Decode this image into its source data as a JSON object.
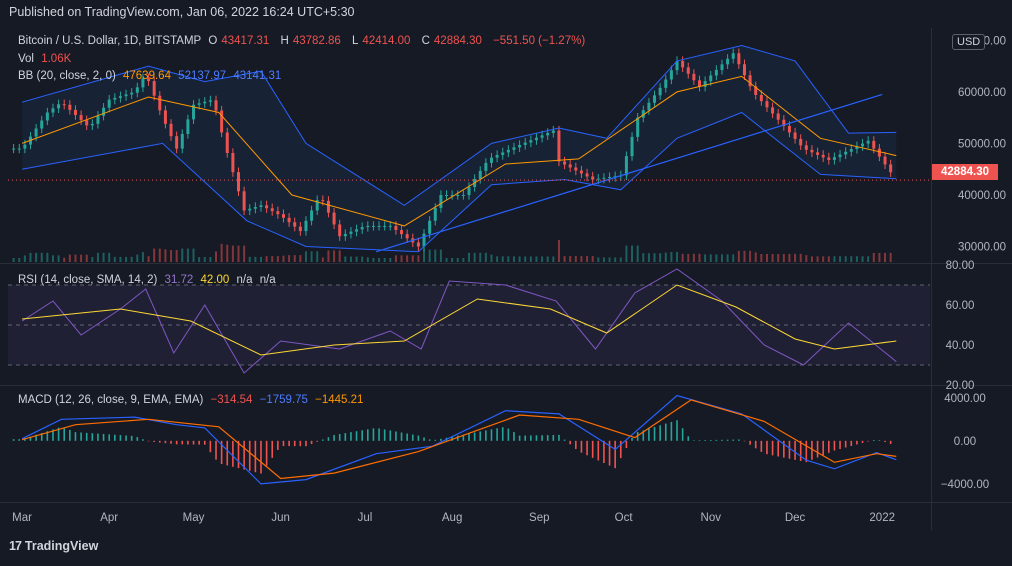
{
  "header": {
    "published": "Published on TradingView.com, Jan 06, 2022 16:24 UTC+5:30"
  },
  "symbol": {
    "name": "Bitcoin / U.S. Dollar, 1D, BITSTAMP",
    "o_label": "O",
    "o_value": "43417.31",
    "h_label": "H",
    "h_value": "43782.86",
    "l_label": "L",
    "l_value": "42414.00",
    "c_label": "C",
    "c_value": "42884.30",
    "change": "−551.50 (−1.27%)"
  },
  "volume": {
    "label": "Vol",
    "value": "1.06K"
  },
  "bb": {
    "label": "BB (20, close, 2, 0)",
    "basis": "47639.64",
    "upper": "52137.97",
    "lower": "43141.31"
  },
  "rsi": {
    "label": "RSI (14, close, SMA, 14, 2)",
    "rsi": "31.72",
    "sma": "42.00",
    "na1": "n/a",
    "na2": "n/a"
  },
  "macd": {
    "label": "MACD (12, 26, close, 9, EMA, EMA)",
    "hist": "−314.54",
    "macd": "−1759.75",
    "signal": "−1445.21"
  },
  "price_axis": {
    "currency": "USD",
    "last_price": "42884.30",
    "ticks": [
      "70000.00",
      "60000.00",
      "50000.00",
      "40000.00",
      "30000.00"
    ],
    "rsi_ticks": [
      "80.00",
      "60.00",
      "40.00",
      "20.00"
    ],
    "macd_ticks": [
      "4000.00",
      "0.00",
      "−4000.00"
    ]
  },
  "time_axis": [
    "Mar",
    "Apr",
    "May",
    "Jun",
    "Jul",
    "Aug",
    "Sep",
    "Oct",
    "Nov",
    "Dec",
    "2022"
  ],
  "footer": {
    "brand": "TradingView",
    "logo": "17"
  },
  "colors": {
    "up": "#26a69a",
    "down": "#ef5350",
    "bb_basis": "#ff9800",
    "bb_band": "#2962ff",
    "rsi": "#7e57c2",
    "rsi_sma": "#fdd835",
    "macd": "#2962ff",
    "signal": "#ff6d00"
  },
  "chart_data": {
    "type": "candlestick",
    "x_range": [
      "2021-03",
      "2022-01-06"
    ],
    "ylim": [
      27000,
      72000
    ],
    "close_series": [
      [
        "2021-03-01",
        49000
      ],
      [
        "2021-03-10",
        56000
      ],
      [
        "2021-03-15",
        58000
      ],
      [
        "2021-03-25",
        53000
      ],
      [
        "2021-04-01",
        58500
      ],
      [
        "2021-04-10",
        60000
      ],
      [
        "2021-04-14",
        63500
      ],
      [
        "2021-04-20",
        55000
      ],
      [
        "2021-04-25",
        49000
      ],
      [
        "2021-05-01",
        57500
      ],
      [
        "2021-05-08",
        58500
      ],
      [
        "2021-05-12",
        50000
      ],
      [
        "2021-05-19",
        37000
      ],
      [
        "2021-05-25",
        38000
      ],
      [
        "2021-06-01",
        36000
      ],
      [
        "2021-06-08",
        33000
      ],
      [
        "2021-06-15",
        40000
      ],
      [
        "2021-06-22",
        32000
      ],
      [
        "2021-07-01",
        34000
      ],
      [
        "2021-07-10",
        34000
      ],
      [
        "2021-07-20",
        30000
      ],
      [
        "2021-07-28",
        40000
      ],
      [
        "2021-08-05",
        40000
      ],
      [
        "2021-08-14",
        47000
      ],
      [
        "2021-08-22",
        49000
      ],
      [
        "2021-09-06",
        52500
      ],
      [
        "2021-09-08",
        46500
      ],
      [
        "2021-09-20",
        43000
      ],
      [
        "2021-09-30",
        43800
      ],
      [
        "2021-10-06",
        55000
      ],
      [
        "2021-10-15",
        61500
      ],
      [
        "2021-10-20",
        66000
      ],
      [
        "2021-10-28",
        61000
      ],
      [
        "2021-11-09",
        67500
      ],
      [
        "2021-11-16",
        60000
      ],
      [
        "2021-11-26",
        54000
      ],
      [
        "2021-12-04",
        49000
      ],
      [
        "2021-12-13",
        46800
      ],
      [
        "2021-12-27",
        50500
      ],
      [
        "2022-01-06",
        42884.3
      ]
    ],
    "bb_upper": [
      [
        "2021-03-01",
        58000
      ],
      [
        "2021-04-15",
        65000
      ],
      [
        "2021-05-05",
        62000
      ],
      [
        "2021-05-25",
        64000
      ],
      [
        "2021-06-10",
        50000
      ],
      [
        "2021-07-15",
        38000
      ],
      [
        "2021-08-15",
        50000
      ],
      [
        "2021-09-08",
        53000
      ],
      [
        "2021-09-25",
        51000
      ],
      [
        "2021-10-20",
        66000
      ],
      [
        "2021-11-12",
        69000
      ],
      [
        "2021-12-01",
        66000
      ],
      [
        "2021-12-20",
        52000
      ],
      [
        "2022-01-06",
        52137.97
      ]
    ],
    "bb_basis": [
      [
        "2021-03-01",
        50000
      ],
      [
        "2021-04-15",
        59000
      ],
      [
        "2021-05-10",
        56000
      ],
      [
        "2021-06-05",
        40000
      ],
      [
        "2021-07-15",
        34000
      ],
      [
        "2021-08-20",
        46000
      ],
      [
        "2021-09-15",
        47000
      ],
      [
        "2021-10-20",
        60000
      ],
      [
        "2021-11-12",
        63000
      ],
      [
        "2021-12-10",
        51000
      ],
      [
        "2022-01-06",
        47639.64
      ]
    ],
    "bb_lower": [
      [
        "2021-03-01",
        45000
      ],
      [
        "2021-04-20",
        50000
      ],
      [
        "2021-05-20",
        35000
      ],
      [
        "2021-06-10",
        30000
      ],
      [
        "2021-07-20",
        29000
      ],
      [
        "2021-08-15",
        42000
      ],
      [
        "2021-09-10",
        43000
      ],
      [
        "2021-09-30",
        41000
      ],
      [
        "2021-10-20",
        51000
      ],
      [
        "2021-11-12",
        56000
      ],
      [
        "2021-12-10",
        44000
      ],
      [
        "2022-01-06",
        43141.31
      ]
    ],
    "trendline": [
      [
        "2021-07-05",
        29000
      ],
      [
        "2022-01-01",
        59500
      ]
    ],
    "rsi_range": [
      20,
      80
    ],
    "rsi_series": [
      [
        "2021-03-01",
        52
      ],
      [
        "2021-03-12",
        62
      ],
      [
        "2021-03-22",
        45
      ],
      [
        "2021-04-05",
        58
      ],
      [
        "2021-04-14",
        68
      ],
      [
        "2021-04-24",
        36
      ],
      [
        "2021-05-05",
        60
      ],
      [
        "2021-05-19",
        26
      ],
      [
        "2021-06-01",
        42
      ],
      [
        "2021-06-22",
        38
      ],
      [
        "2021-07-10",
        47
      ],
      [
        "2021-07-21",
        38
      ],
      [
        "2021-07-31",
        72
      ],
      [
        "2021-08-20",
        70
      ],
      [
        "2021-09-07",
        62
      ],
      [
        "2021-09-21",
        38
      ],
      [
        "2021-10-05",
        66
      ],
      [
        "2021-10-20",
        78
      ],
      [
        "2021-11-05",
        62
      ],
      [
        "2021-11-20",
        40
      ],
      [
        "2021-12-04",
        30
      ],
      [
        "2021-12-20",
        51
      ],
      [
        "2022-01-06",
        31.72
      ]
    ],
    "rsi_sma_series": [
      [
        "2021-03-01",
        53
      ],
      [
        "2021-04-05",
        58
      ],
      [
        "2021-04-30",
        52
      ],
      [
        "2021-05-25",
        35
      ],
      [
        "2021-06-20",
        40
      ],
      [
        "2021-07-15",
        42
      ],
      [
        "2021-08-10",
        63
      ],
      [
        "2021-09-05",
        58
      ],
      [
        "2021-09-25",
        46
      ],
      [
        "2021-10-20",
        70
      ],
      [
        "2021-11-10",
        59
      ],
      [
        "2021-12-01",
        43
      ],
      [
        "2021-12-15",
        38
      ],
      [
        "2022-01-06",
        42.0
      ]
    ],
    "macd_range": [
      -5500,
      5000
    ],
    "macd_series": [
      [
        "2021-03-01",
        200
      ],
      [
        "2021-03-15",
        2000
      ],
      [
        "2021-04-10",
        2200
      ],
      [
        "2021-04-25",
        1500
      ],
      [
        "2021-05-05",
        1200
      ],
      [
        "2021-05-25",
        -4000
      ],
      [
        "2021-06-10",
        -3600
      ],
      [
        "2021-07-05",
        -1200
      ],
      [
        "2021-07-25",
        -500
      ],
      [
        "2021-08-20",
        2800
      ],
      [
        "2021-09-08",
        2500
      ],
      [
        "2021-09-28",
        -800
      ],
      [
        "2021-10-20",
        4200
      ],
      [
        "2021-11-12",
        2500
      ],
      [
        "2021-12-05",
        -1800
      ],
      [
        "2021-12-15",
        -2600
      ],
      [
        "2021-12-30",
        -1100
      ],
      [
        "2022-01-06",
        -1759.75
      ]
    ],
    "signal_series": [
      [
        "2021-03-01",
        100
      ],
      [
        "2021-03-20",
        1500
      ],
      [
        "2021-04-15",
        2000
      ],
      [
        "2021-05-10",
        1300
      ],
      [
        "2021-06-01",
        -3500
      ],
      [
        "2021-06-20",
        -3000
      ],
      [
        "2021-07-20",
        -1000
      ],
      [
        "2021-08-25",
        2400
      ],
      [
        "2021-09-15",
        2000
      ],
      [
        "2021-10-05",
        300
      ],
      [
        "2021-10-25",
        3800
      ],
      [
        "2021-11-20",
        1800
      ],
      [
        "2021-12-15",
        -2000
      ],
      [
        "2021-12-30",
        -1200
      ],
      [
        "2022-01-06",
        -1445.21
      ]
    ]
  }
}
